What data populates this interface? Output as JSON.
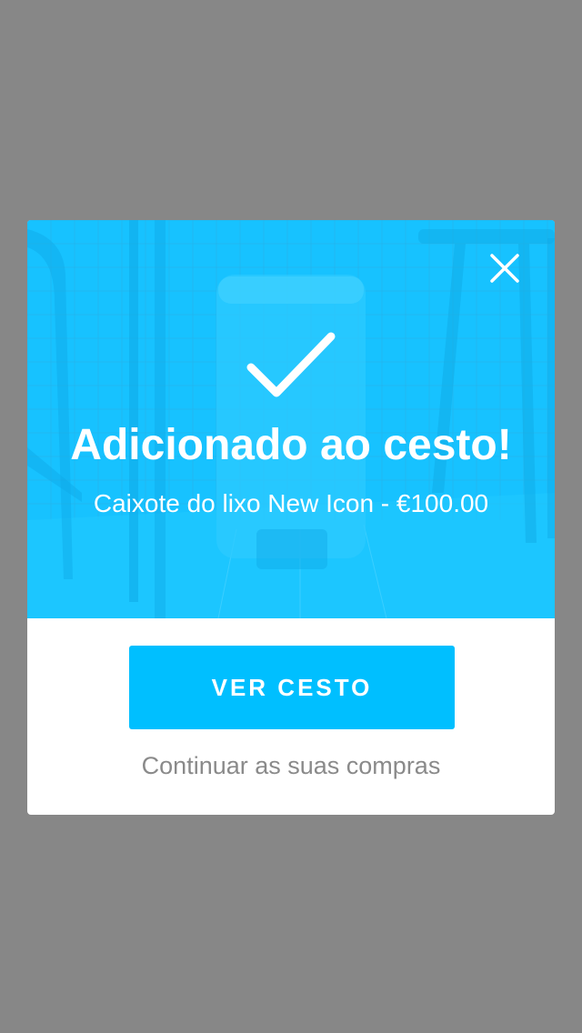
{
  "modal": {
    "title": "Adicionado ao cesto!",
    "subtitle": "Caixote do lixo New Icon - €100.00",
    "primary_button_label": "VER CESTO",
    "secondary_link_label": "Continuar as suas compras",
    "close_icon": "close-icon",
    "check_icon": "checkmark-icon"
  },
  "colors": {
    "overlay": "#878787",
    "hero_background": "#17c2ff",
    "primary_button": "#00bfff",
    "secondary_text": "#8a8a8a",
    "modal_background": "#ffffff"
  }
}
